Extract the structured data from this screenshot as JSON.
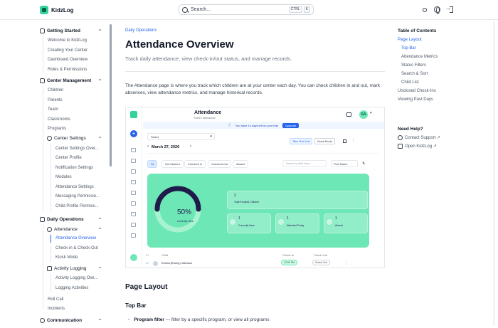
{
  "app": {
    "logo_text": "KidzLog",
    "search_placeholder": "Search...",
    "search_kbd": [
      "CTRL",
      "K"
    ],
    "header_icons": [
      "sun-icon",
      "globe-icon",
      "sign-out-icon"
    ]
  },
  "sidebar": {
    "sections": [
      {
        "label": "Getting Started",
        "icon": "rocket-icon",
        "items": [
          "Welcome to KidzLog",
          "Creating Your Center",
          "Dashboard Overview",
          "Roles & Permissions"
        ]
      },
      {
        "label": "Center Management",
        "icon": "building-icon",
        "items": [
          "Children",
          "Parents",
          "Team",
          "Classrooms",
          "Programs"
        ],
        "subsection": {
          "label": "Center Settings",
          "icon": "gear-icon",
          "items": [
            "Center Settings Over...",
            "Center Profile",
            "Notification Settings",
            "Modules",
            "Attendance Settings",
            "Messaging Permissio...",
            "Child Profile Permiss..."
          ]
        }
      },
      {
        "label": "Daily Operations",
        "icon": "calendar-icon",
        "subsections": [
          {
            "label": "Attendance",
            "icon": "user-check-icon",
            "items": [
              "Attendance Overview",
              "Check-in & Check-Out",
              "Kiosk Mode"
            ],
            "active": "Attendance Overview"
          },
          {
            "label": "Activity Logging",
            "icon": "clipboard-icon",
            "items": [
              "Activity Logging Ove...",
              "Logging Activities"
            ]
          }
        ],
        "items": [
          "Roll Call",
          "Incidents"
        ]
      },
      {
        "label": "Communication",
        "icon": "chat-icon",
        "items": []
      }
    ]
  },
  "main": {
    "breadcrumb": "Daily Operations",
    "title": "Attendance Overview",
    "subtitle": "Track daily attendance, view check-in/out status, and manage records.",
    "intro": "The Attendance page is where you track which children are at your center each day. You can check children in and out, mark absences, view attendance metrics, and manage historical records.",
    "section_title": "Page Layout",
    "subsection_title": "Top Bar",
    "bullet_term": "Program filter",
    "bullet_text": " — filter by a specific program, or view all programs"
  },
  "screenshot": {
    "title": "Attendance",
    "crumbs": "Home  /  Attendance",
    "avatar": "SA",
    "trial_text": "You have 14 days left on your trial",
    "upgrade": "Upgrade",
    "select": "Select",
    "add_roll_call": "Take Roll Call",
    "kiosk": "Kiosk Mode",
    "date": "March 27, 2026",
    "tabs": [
      "All",
      "Not Marked",
      "Checked In",
      "Checked Out",
      "Absent"
    ],
    "search_placeholder": "Search by child name...",
    "sort": "First Name",
    "gauge_percent": 50,
    "gauge_label": "50%",
    "gauge_caption": "Currently Here",
    "total_value": "2",
    "total_label": "Total Enrolled Children",
    "stats": [
      {
        "value": "1",
        "label": "Currently Here"
      },
      {
        "value": "1",
        "label": "Attended Today"
      },
      {
        "value": "1",
        "label": "Absent"
      }
    ],
    "table_headers": [
      "Child",
      "Check-In",
      "Check-Out"
    ],
    "row": {
      "name": "Emma (Emmy) Johnson",
      "checkin": "12:00 PM",
      "checkout": "Check-Out"
    }
  },
  "toc": {
    "title": "Table of Contents",
    "items": [
      {
        "label": "Page Layout",
        "level": 0,
        "active": true
      },
      {
        "label": "Top Bar",
        "level": 1,
        "active": true
      },
      {
        "label": "Attendance Metrics",
        "level": 1,
        "active": false
      },
      {
        "label": "Status Filters",
        "level": 1,
        "active": false
      },
      {
        "label": "Search & Sort",
        "level": 1,
        "active": false
      },
      {
        "label": "Child List",
        "level": 1,
        "active": false
      },
      {
        "label": "Unclosed Check-Ins",
        "level": 0,
        "active": false
      },
      {
        "label": "Viewing Past Days",
        "level": 0,
        "active": false
      }
    ],
    "help_title": "Need Help?",
    "help_links": [
      "Contact Support ↗",
      "Open KidzLog ↗"
    ]
  },
  "colors": {
    "accent": "#2563eb",
    "brand": "#34d399",
    "panel": "#6ee7b7",
    "gauge": "#1e1b4b"
  }
}
